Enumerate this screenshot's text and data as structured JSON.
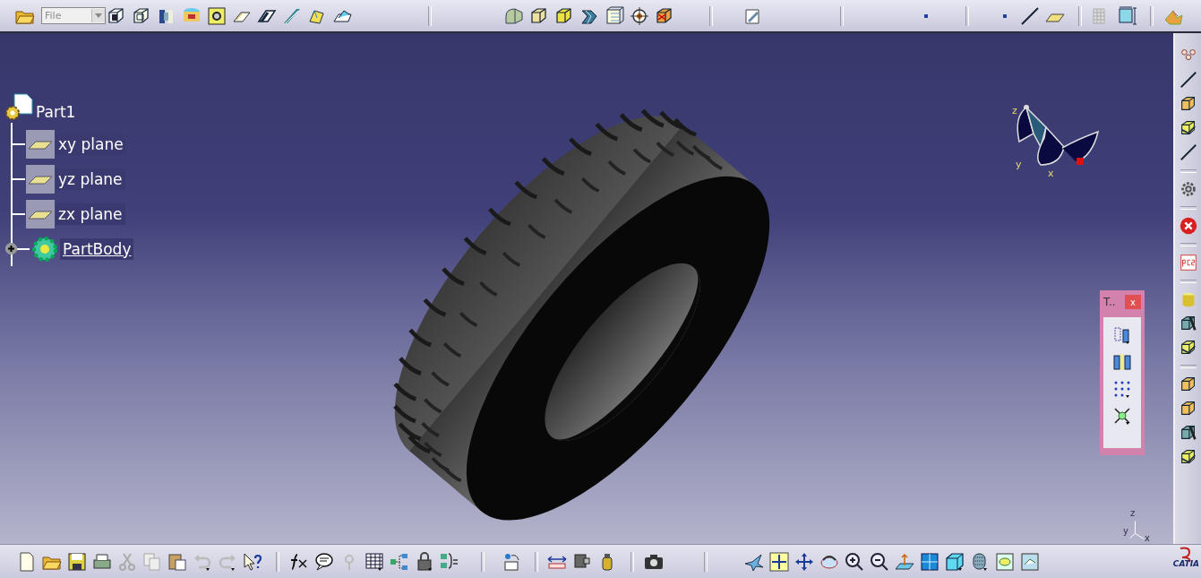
{
  "top_toolbar": {
    "file_combo": {
      "value": "File"
    }
  },
  "tree": {
    "root": {
      "label": "Part1",
      "children": [
        {
          "label": "xy plane",
          "kind": "plane",
          "current": false
        },
        {
          "label": "yz plane",
          "kind": "plane",
          "current": false
        },
        {
          "label": "zx plane",
          "kind": "plane",
          "current": false
        },
        {
          "label": "PartBody",
          "kind": "body",
          "current": true,
          "expanded": false
        }
      ]
    }
  },
  "compass": {
    "axes": [
      "z",
      "y",
      "x"
    ]
  },
  "floating_toolbar": {
    "title": "T..",
    "close": "x"
  },
  "mini_axis": {
    "labels": [
      "z",
      "y",
      "x"
    ]
  },
  "logo": {
    "text": "CATIA"
  }
}
